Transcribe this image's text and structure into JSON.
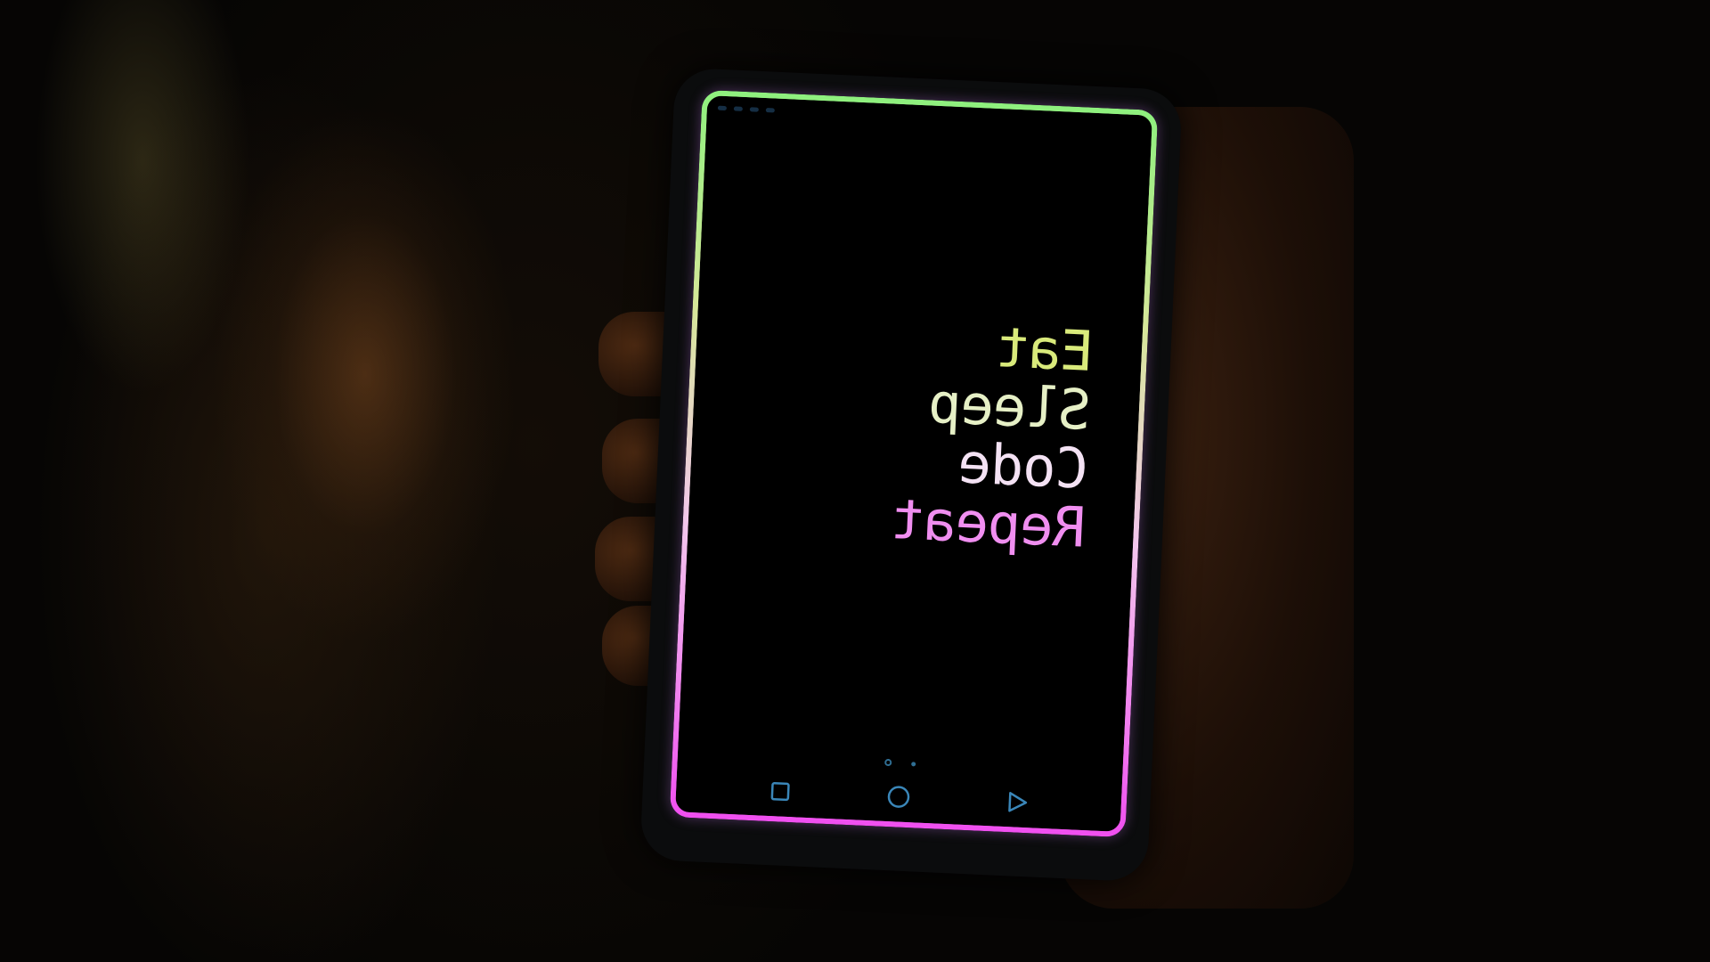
{
  "screen": {
    "mirrored_words": [
      "Eat",
      "Sleep",
      "Code",
      "Repeat"
    ]
  },
  "colors": {
    "border_top": "#8ef07e",
    "border_bottom": "#f04ff0",
    "word_eat": "#d9ea7b",
    "word_sleep": "#e6f0c6",
    "word_code": "#f4e2f4",
    "word_repeat": "#f08ef0",
    "nav_icons": "#3a86b8"
  },
  "navigation": {
    "buttons": [
      {
        "icon": "square-recents-icon"
      },
      {
        "icon": "circle-home-icon"
      },
      {
        "icon": "triangle-back-icon"
      }
    ],
    "page_indicator": {
      "pages": 2,
      "current": 1
    }
  }
}
